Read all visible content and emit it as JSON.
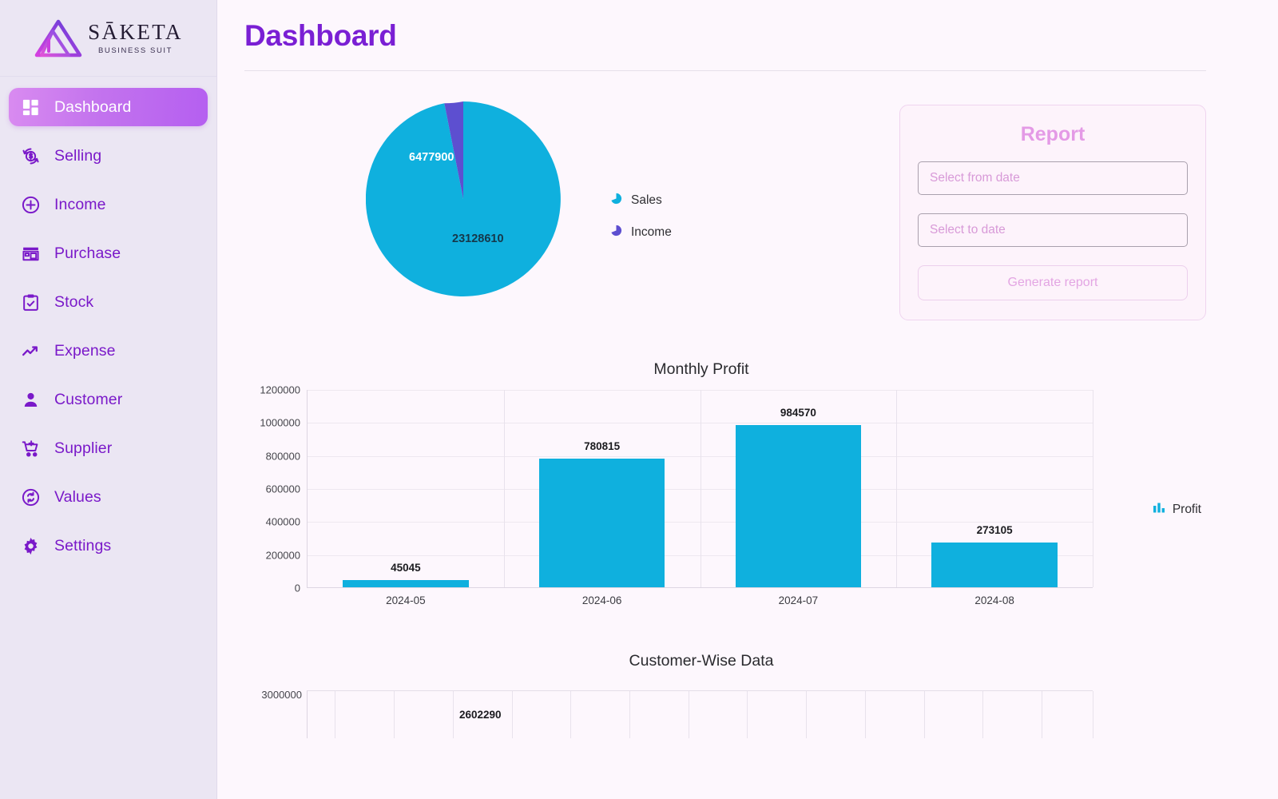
{
  "brand": {
    "name": "SĀKETA",
    "tagline": "BUSINESS SUIT",
    "logo_icon": "triangle-logo-icon"
  },
  "sidebar": {
    "items": [
      {
        "label": "Dashboard",
        "icon": "dashboard-grid-icon",
        "active": true
      },
      {
        "label": "Selling",
        "icon": "selling-exchange-icon",
        "active": false
      },
      {
        "label": "Income",
        "icon": "plus-circle-icon",
        "active": false
      },
      {
        "label": "Purchase",
        "icon": "store-icon",
        "active": false
      },
      {
        "label": "Stock",
        "icon": "clipboard-check-icon",
        "active": false
      },
      {
        "label": "Expense",
        "icon": "trending-up-icon",
        "active": false
      },
      {
        "label": "Customer",
        "icon": "user-icon",
        "active": false
      },
      {
        "label": "Supplier",
        "icon": "cart-plus-icon",
        "active": false
      },
      {
        "label": "Values",
        "icon": "refresh-circle-icon",
        "active": false
      },
      {
        "label": "Settings",
        "icon": "gear-icon",
        "active": false
      }
    ]
  },
  "header": {
    "title": "Dashboard"
  },
  "report": {
    "title": "Report",
    "from_date_placeholder": "Select from date",
    "from_date_value": "",
    "to_date_placeholder": "Select to date",
    "to_date_value": "",
    "generate_label": "Generate report"
  },
  "colors": {
    "sales": "#0fb0de",
    "income": "#5d4fd0",
    "accent_purple": "#7a1fd4",
    "nav_active_start": "#d98bf0",
    "nav_active_end": "#b55ff0",
    "report_pink": "#e49ae6",
    "sidebar_bg": "#ebe6f3",
    "main_bg": "#fdf7fd"
  },
  "chart_data": [
    {
      "type": "pie",
      "title": "",
      "labels": [
        "Sales",
        "Income"
      ],
      "values": [
        23128610,
        6477900
      ],
      "value_labels": [
        "23128610",
        "6477900"
      ],
      "colors": [
        "#0fb0de",
        "#5d4fd0"
      ],
      "legend_position": "right",
      "legend": [
        "Sales",
        "Income"
      ]
    },
    {
      "type": "bar",
      "title": "Monthly Profit",
      "categories": [
        "2024-05",
        "2024-06",
        "2024-07",
        "2024-08"
      ],
      "values": [
        45045,
        780815,
        984570,
        273105
      ],
      "value_labels": [
        "45045",
        "780815",
        "984570",
        "273105"
      ],
      "series": [
        {
          "name": "Profit",
          "values": [
            45045,
            780815,
            984570,
            273105
          ]
        }
      ],
      "ylim": [
        0,
        1200000
      ],
      "yticks": [
        0,
        200000,
        400000,
        600000,
        800000,
        1000000,
        1200000
      ],
      "ytick_labels": [
        "0",
        "200000",
        "400000",
        "600000",
        "800000",
        "1000000",
        "1200000"
      ],
      "xlabel": "",
      "ylabel": "",
      "grid": true,
      "legend": [
        "Profit"
      ],
      "legend_position": "right",
      "color": "#0fb0de"
    },
    {
      "type": "bar",
      "title": "Customer-Wise Data",
      "categories": [],
      "values": [
        2602290
      ],
      "value_labels": [
        "2602290"
      ],
      "ylim": [
        0,
        3000000
      ],
      "yticks": [
        3000000
      ],
      "ytick_labels": [
        "3000000"
      ],
      "grid": true,
      "color": "#0fb0de",
      "note": "chart cut off at bottom of viewport"
    }
  ]
}
